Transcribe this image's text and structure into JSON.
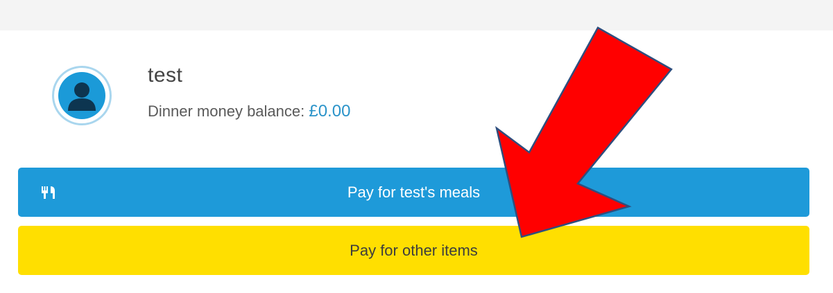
{
  "child": {
    "name": "test",
    "balance_label": "Dinner money balance: ",
    "balance_value": "£0.00"
  },
  "buttons": {
    "meals_label": "Pay for test's meals",
    "other_label": "Pay for other items"
  },
  "icons": {
    "avatar": "user-avatar-icon",
    "meals": "cutlery-icon",
    "annotation": "red-arrow"
  },
  "colors": {
    "meals_button": "#1e9ad9",
    "other_button": "#ffdf00",
    "balance": "#2a93c9",
    "arrow": "#ff0000"
  }
}
